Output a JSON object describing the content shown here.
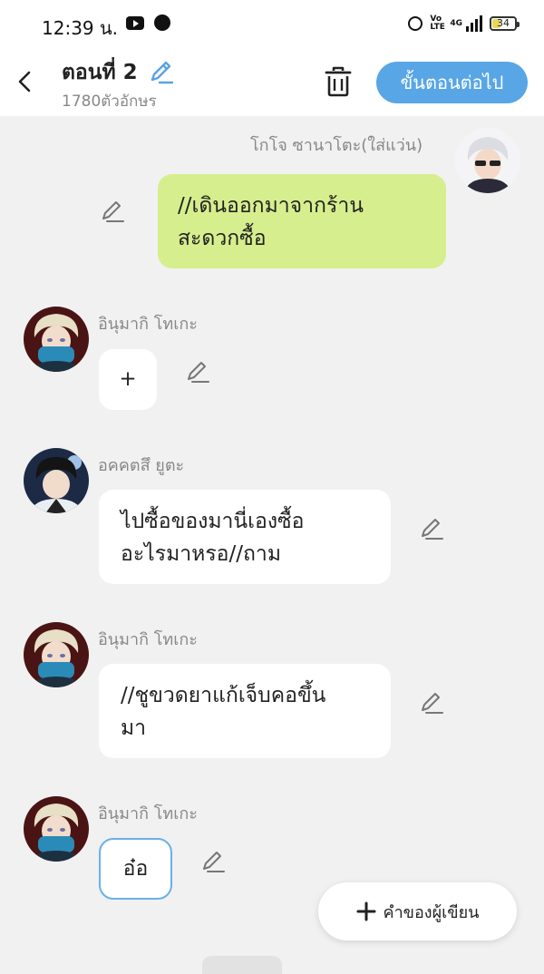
{
  "status_bar": {
    "time": "12:39 น.",
    "network": "4G",
    "battery": "34"
  },
  "header": {
    "title": "ตอนที่ 2",
    "char_count": "1780ตัวอักษร",
    "next_button": "ขั้นตอนต่อไป"
  },
  "messages": [
    {
      "speaker": "โกโจ ซานาโตะ(ใส่แว่น)",
      "text": "//เดินออกมาจากร้าน\nสะดวกซื้อ",
      "side": "right",
      "bubble_color": "#d6ee8d"
    },
    {
      "speaker": "อินุมากิ โทเกะ",
      "text": "+",
      "side": "left"
    },
    {
      "speaker": "อคคตสึ ยูตะ",
      "text": "ไปซื้อของมานี่เองซื้อ\nอะไรมาหรอ//ถาม",
      "side": "left"
    },
    {
      "speaker": "อินุมากิ โทเกะ",
      "text": "//ชูขวดยาแก้เจ็บคอขึ้น\nมา",
      "side": "left"
    },
    {
      "speaker": "อินุมากิ โทเกะ",
      "text": "อ๋อ",
      "side": "left",
      "selected": true
    }
  ],
  "fab": {
    "label": "คำของผู้เขียน"
  },
  "colors": {
    "accent": "#58a6e6",
    "background": "#f1f1f1",
    "bubble_white": "#ffffff"
  },
  "icons": [
    "back-arrow-icon",
    "pencil-icon",
    "trash-icon",
    "plus-icon",
    "alarm-icon",
    "signal-icon",
    "battery-icon"
  ]
}
